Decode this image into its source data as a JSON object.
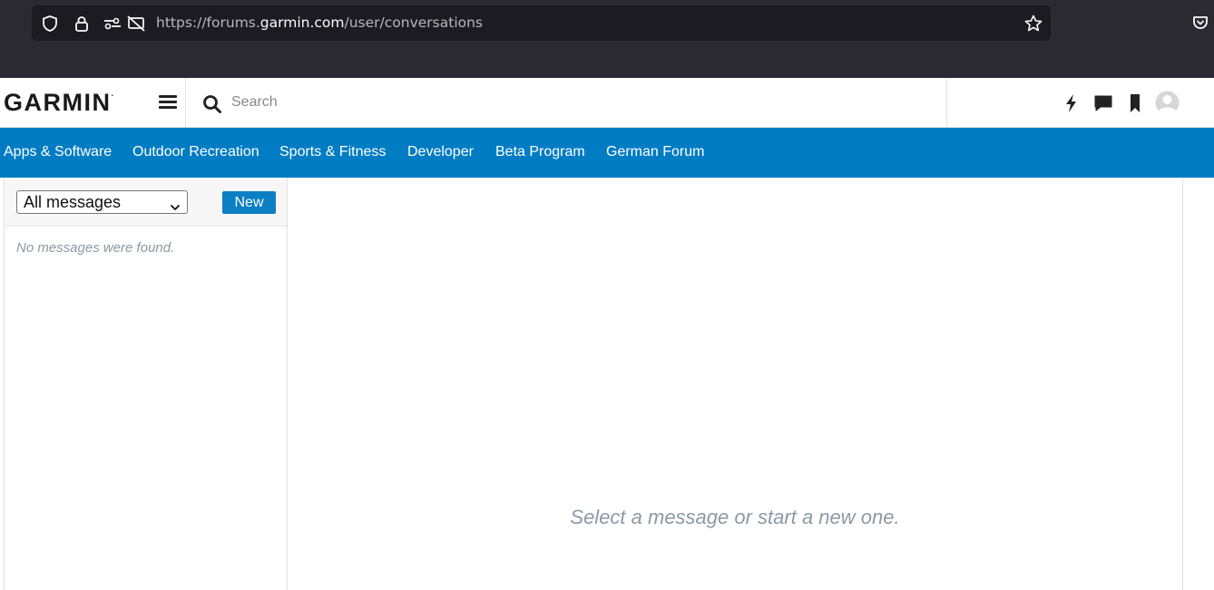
{
  "browser": {
    "url_prefix": "https://forums.",
    "url_host": "garmin.com",
    "url_path": "/user/conversations"
  },
  "header": {
    "logo_text": "GARMIN",
    "logo_mark": ".",
    "search_placeholder": "Search"
  },
  "nav": {
    "items": [
      "Apps & Software",
      "Outdoor Recreation",
      "Sports & Fitness",
      "Developer",
      "Beta Program",
      "German Forum"
    ]
  },
  "messages": {
    "filter_selected": "All messages",
    "new_label": "New",
    "empty_list_text": "No messages were found.",
    "empty_main_text": "Select a message or start a new one."
  },
  "colors": {
    "nav_bg": "#007cc3",
    "button_bg": "#0b7fc4",
    "muted_text": "#8a99a6"
  },
  "icons": [
    "shield-icon",
    "lock-icon",
    "permissions-icon",
    "tracking-blocked-icon",
    "bookmark-star-icon",
    "pocket-icon",
    "menu-icon",
    "search-icon",
    "lightning-icon",
    "chat-icon",
    "bookmark-icon",
    "user-avatar-icon",
    "chevron-down-icon"
  ]
}
